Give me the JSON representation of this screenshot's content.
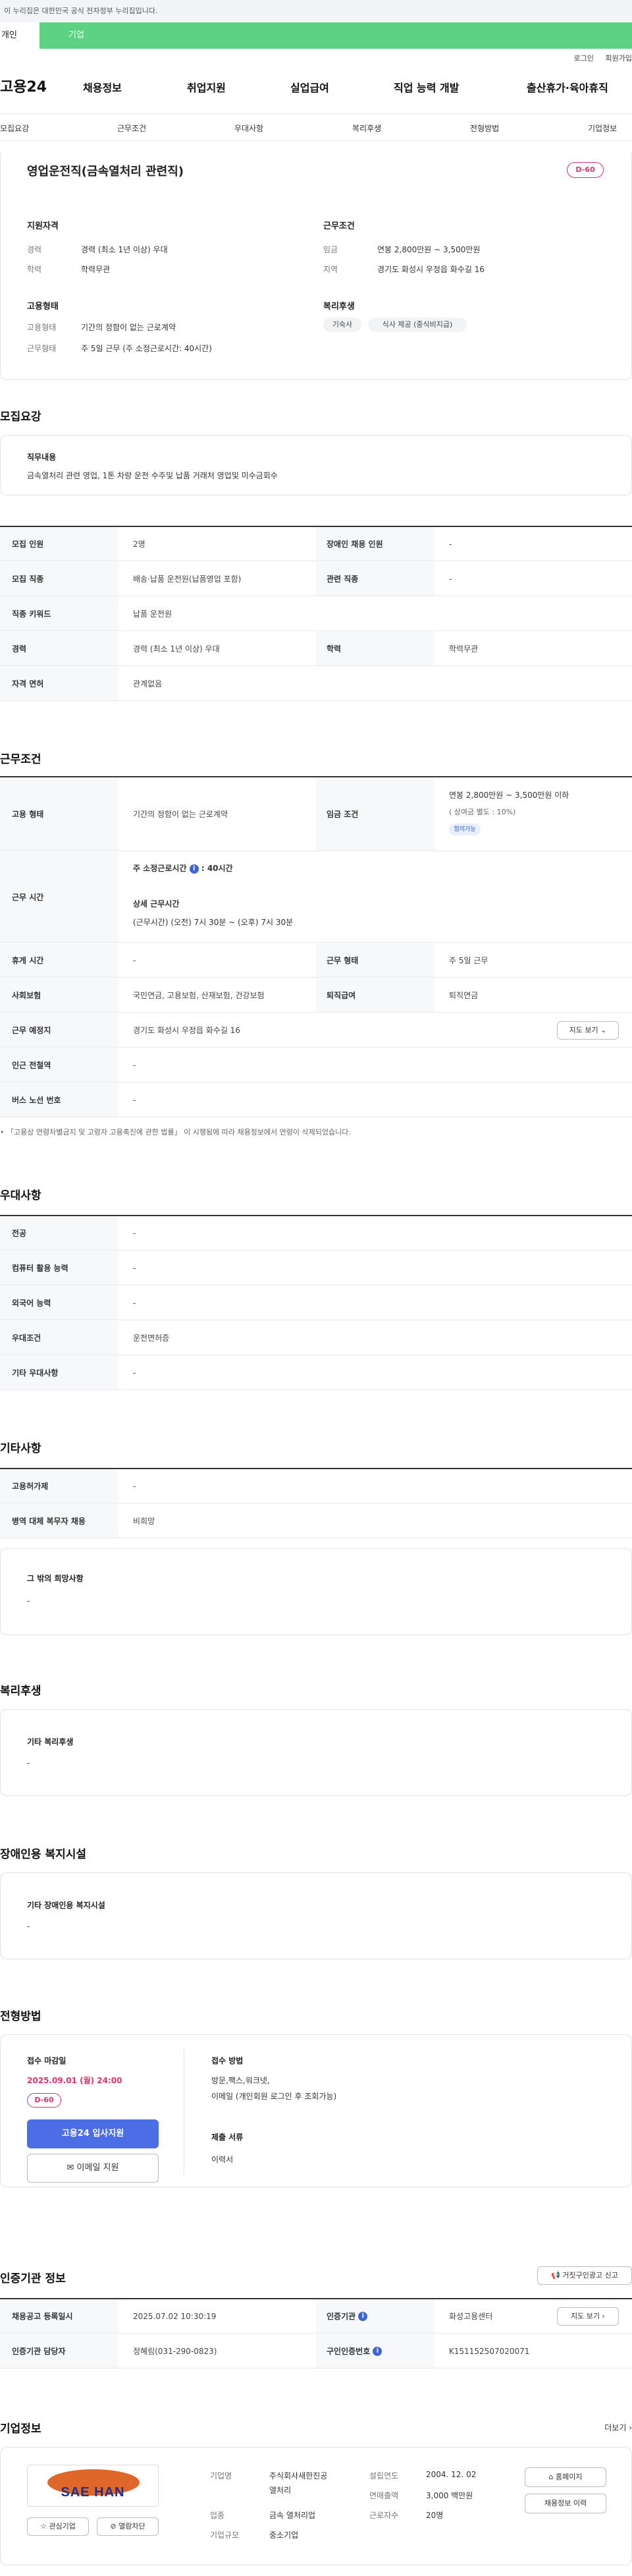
{
  "top_notice": "이 누리집은 대한민국 공식 전자정부 누리집입니다.",
  "tabs": {
    "person": "개인",
    "company": "기업"
  },
  "util": {
    "login": "로그인",
    "join": "회원가입"
  },
  "logo": "고용24",
  "gnb": [
    "채용정보",
    "취업지원",
    "실업급여",
    "직업 능력 개발",
    "출산휴가·육아휴직"
  ],
  "subnav": [
    "모집요강",
    "근무조건",
    "우대사항",
    "복리후생",
    "전형방법",
    "기업정보"
  ],
  "summary": {
    "title": "영업운전직(금속열처리 관련직)",
    "dday": "D-60",
    "qual_h": "지원자격",
    "career_k": "경력",
    "career_v": "경력 (최소 1년 이상) 우대",
    "edu_k": "학력",
    "edu_v": "학력무관",
    "emp_h": "고용형태",
    "emp_k": "고용형태",
    "emp_v": "기간의 정함이 없는 근로계약",
    "work_k": "근무형태",
    "work_v": "주 5일 근무 (주 소정근로시간: 40시간)",
    "cond_h": "근무조건",
    "wage_k": "임금",
    "wage_v": "연봉 2,800만원 ~ 3,500만원",
    "area_k": "지역",
    "area_v": "경기도 화성시 우정읍 화수길 16",
    "welfare_h": "복리후생",
    "chips": [
      "기숙사",
      "식사 제공 (중식비지급)"
    ]
  },
  "recruit": {
    "h": "모집요강",
    "duty_h": "직무내용",
    "duty_v": "금속열처리 관련 영업, 1톤 차량 운전 수주및 납품 거래처 영업및 미수금회수",
    "rows": [
      {
        "k": "모집 인원",
        "v": "2명",
        "k2": "장애인 채용 인원",
        "v2": "-"
      },
      {
        "k": "모집 직종",
        "v": "배송·납품 운전원(납품영업 포함)",
        "k2": "관련 직종",
        "v2": "-"
      },
      {
        "k": "직종 키워드",
        "v": "납품 운전원"
      },
      {
        "k": "경력",
        "v": "경력 (최소 1년 이상) 우대",
        "k2": "학력",
        "v2": "학력무관"
      },
      {
        "k": "자격 면허",
        "v": "관계없음"
      }
    ]
  },
  "workcond": {
    "h": "근무조건",
    "emp_k": "고용 형태",
    "emp_v": "기간의 정함이 없는 근로계약",
    "wage_k": "임금 조건",
    "wage_v": "연봉 2,800만원 ~ 3,500만원 이하",
    "wage_sub": "( 상여금 별도 : 10%)",
    "wage_badge": "협의가능",
    "hours_k": "근무 시간",
    "hours_1": "주 소정근로시간",
    "hours_1v": ": 40시간",
    "hours_2": "상세 근무시간",
    "hours_2v": "(근무시간) (오전) 7시 30분 ~ (오후) 7시 30분",
    "rest_k": "휴게 시간",
    "rest_v": "-",
    "form_k": "근무 형태",
    "form_v": "주 5일 근무",
    "ins_k": "사회보험",
    "ins_v": "국민연금, 고용보험, 산재보험, 건강보험",
    "ret_k": "퇴직급여",
    "ret_v": "퇴직연금",
    "loc_k": "근무 예정지",
    "loc_v": "경기도 화성시 우정읍 화수길 16",
    "map_btn": "지도 보기",
    "sub_k": "인근 전철역",
    "sub_v": "-",
    "bus_k": "버스 노선 번호",
    "bus_v": "-",
    "note": "「고용상 연령차별금지 및 고령자 고용촉진에 관한 법률」 이 시행됨에 따라 채용정보에서 연령이 삭제되었습니다."
  },
  "pref": {
    "h": "우대사항",
    "rows": [
      {
        "k": "전공",
        "v": "-"
      },
      {
        "k": "컴퓨터 활용 능력",
        "v": "-"
      },
      {
        "k": "외국어 능력",
        "v": "-"
      },
      {
        "k": "우대조건",
        "v": "운전면허증"
      },
      {
        "k": "기타 우대사항",
        "v": "-"
      }
    ]
  },
  "etc": {
    "h": "기타사항",
    "rows": [
      {
        "k": "고용허가제",
        "v": "-"
      },
      {
        "k": "병역 대체 복무자 채용",
        "v": "비희망"
      }
    ],
    "box_h": "그 밖의 희망사항",
    "box_v": "-"
  },
  "welfare": {
    "h": "복리후생",
    "box_h": "기타 복리후생",
    "box_v": "-"
  },
  "disabled": {
    "h": "장애인용 복지시설",
    "box_h": "기타 장애인용 복지시설",
    "box_v": "-"
  },
  "screening": {
    "h": "전형방법",
    "deadline_h": "접수 마감일",
    "deadline_v": "2025.09.01 (월) 24:00",
    "dday": "D-60",
    "apply_btn": "고용24 입사지원",
    "email_btn": "이메일 지원",
    "method_h": "접수 방법",
    "method_v1": "방문,팩스,워크넷,",
    "method_v2": "이메일 (개인회원 로그인 후 조회가능)",
    "docs_h": "제출 서류",
    "docs_v": "이력서"
  },
  "cert": {
    "h": "인증기관 정보",
    "report_btn": "거짓구인광고 신고",
    "reg_k": "채용공고 등록일시",
    "reg_v": "2025.07.02 10:30:19",
    "org_k": "인증기관",
    "org_v": "화성고용센터",
    "map_btn": "지도 보기",
    "mgr_k": "인증기관 담당자",
    "mgr_v": "정혜림(031-290-0823)",
    "num_k": "구인인증번호",
    "num_v": "K151152507020071"
  },
  "company": {
    "h": "기업정보",
    "more": "더보기",
    "logo_text": "SAE HAN",
    "fav_btn": "관심기업",
    "block_btn": "열람차단",
    "name_k": "기업명",
    "name_v1": "주식회사새한진공",
    "name_v2": "열처리",
    "ind_k": "업종",
    "ind_v": "금속 열처리업",
    "size_k": "기업규모",
    "size_v": "중소기업",
    "year_k": "설립연도",
    "year_v": "2004. 12. 02",
    "sales_k": "연매출액",
    "sales_v": "3,000 백만원",
    "emp_k": "근로자수",
    "emp_v": "20명",
    "home_btn": "홈페이지",
    "hist_btn": "채용정보 이력"
  },
  "colors": {
    "accent_green": "#5dd282",
    "dday_pink": "#e2336b",
    "primary_blue": "#4b6ee6"
  }
}
